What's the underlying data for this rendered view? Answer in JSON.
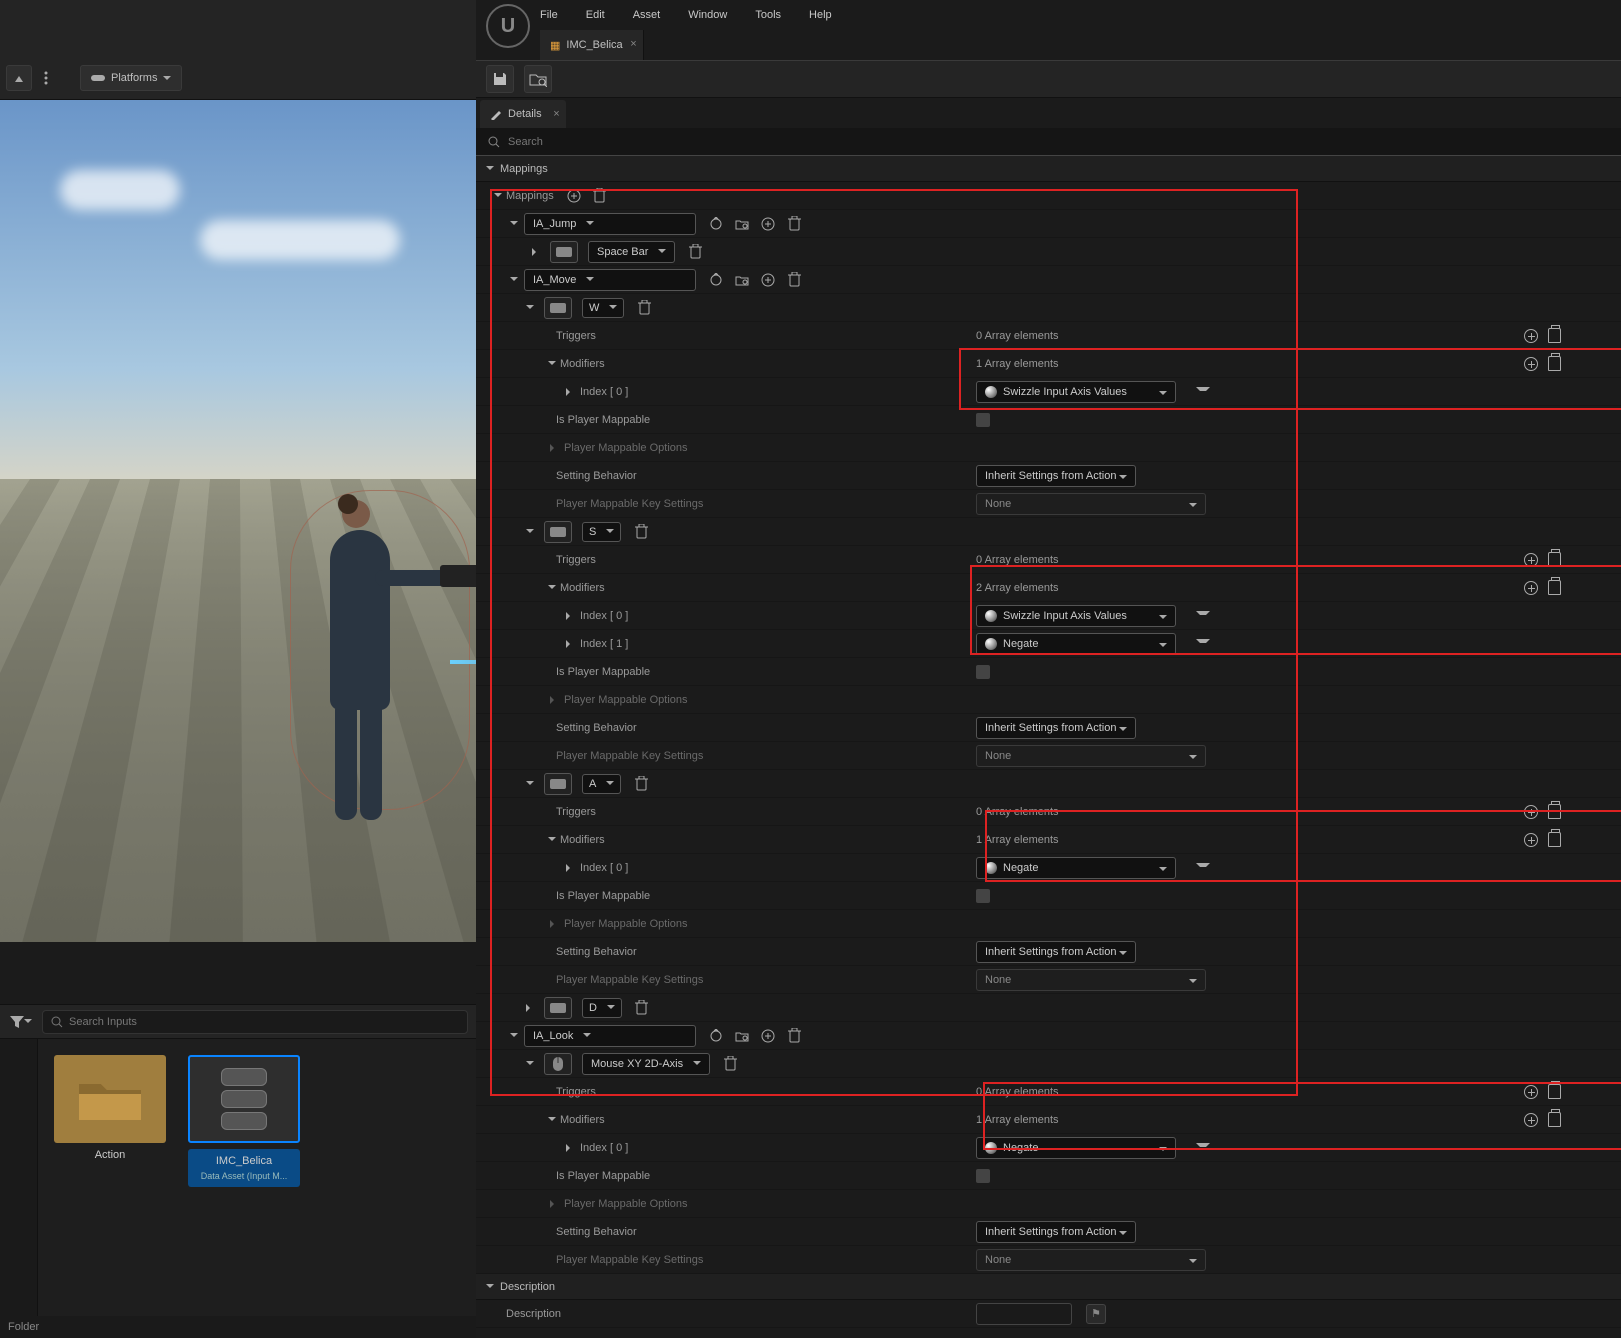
{
  "menubar": {
    "items": [
      "File",
      "Edit",
      "Asset",
      "Window",
      "Tools",
      "Help"
    ]
  },
  "tab": {
    "name": "IMC_Belica"
  },
  "platforms": {
    "label": "Platforms"
  },
  "details": {
    "tab_label": "Details",
    "search_placeholder": "Search",
    "sections": {
      "mappings": "Mappings",
      "description": "Description"
    },
    "mappings_label": "Mappings"
  },
  "actions": {
    "jump": {
      "name": "IA_Jump",
      "key": "Space Bar"
    },
    "move": {
      "name": "IA_Move"
    },
    "look": {
      "name": "IA_Look",
      "key": "Mouse XY 2D-Axis"
    }
  },
  "keys": {
    "w": "W",
    "s": "S",
    "a": "A",
    "d": "D"
  },
  "labels": {
    "triggers": "Triggers",
    "modifiers": "Modifiers",
    "index0": "Index [ 0 ]",
    "index1": "Index [ 1 ]",
    "is_player_mappable": "Is Player Mappable",
    "player_mappable_options": "Player Mappable Options",
    "setting_behavior": "Setting Behavior",
    "player_mappable_key_settings": "Player Mappable Key Settings",
    "description": "Description"
  },
  "values": {
    "array0": "0 Array elements",
    "array1": "1 Array elements",
    "array2": "2 Array elements",
    "swizzle": "Swizzle Input Axis Values",
    "negate": "Negate",
    "inherit": "Inherit Settings from Action",
    "none": "None"
  },
  "content_browser": {
    "search_placeholder": "Search Inputs",
    "folder": "Action",
    "asset": "IMC_Belica",
    "asset_type": "Data Asset (Input M...",
    "footer": "Folder"
  }
}
